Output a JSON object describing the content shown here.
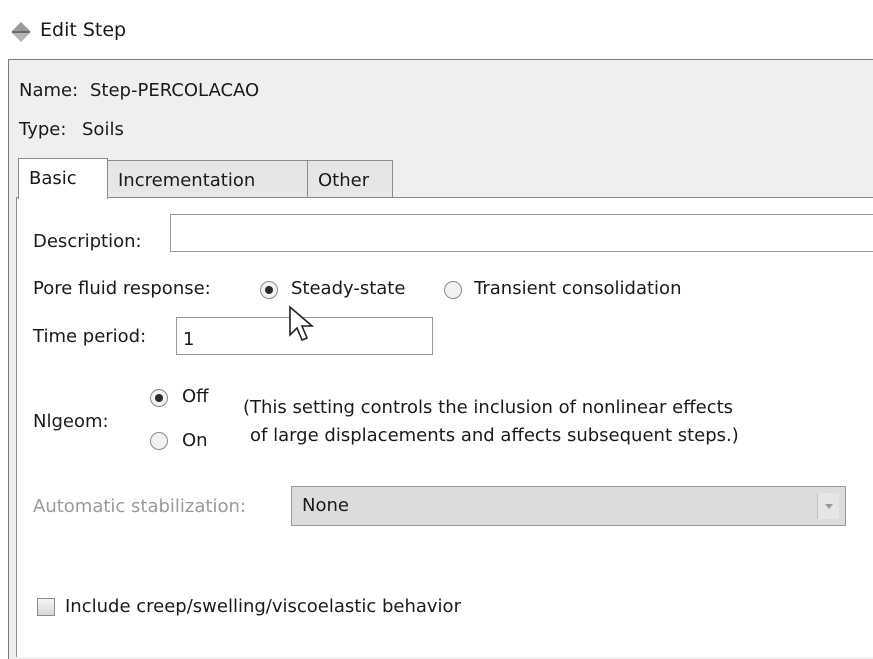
{
  "window": {
    "title": "Edit Step",
    "icon": "step-icon"
  },
  "step": {
    "name_label": "Name:",
    "name_value": "Step-PERCOLACAO",
    "type_label": "Type:",
    "type_value": "Soils"
  },
  "tabs": [
    {
      "label": "Basic",
      "active": true
    },
    {
      "label": "Incrementation",
      "active": false
    },
    {
      "label": "Other",
      "active": false
    }
  ],
  "basic": {
    "description_label": "Description:",
    "description_value": "",
    "pore_label": "Pore fluid response:",
    "pore_options": [
      {
        "label": "Steady-state",
        "checked": true
      },
      {
        "label": "Transient consolidation",
        "checked": false
      }
    ],
    "time_label": "Time period:",
    "time_value": "1",
    "nlgeom_label": "Nlgeom:",
    "nlgeom_options": [
      {
        "label": "Off",
        "checked": true
      },
      {
        "label": "On",
        "checked": false
      }
    ],
    "nlgeom_note_1": "(This setting controls the inclusion of nonlinear effects",
    "nlgeom_note_2": "of large displacements and affects subsequent steps.)",
    "stab_label": "Automatic stabilization:",
    "stab_value": "None",
    "creep_label": "Include creep/swelling/viscoelastic behavior",
    "creep_checked": false
  }
}
